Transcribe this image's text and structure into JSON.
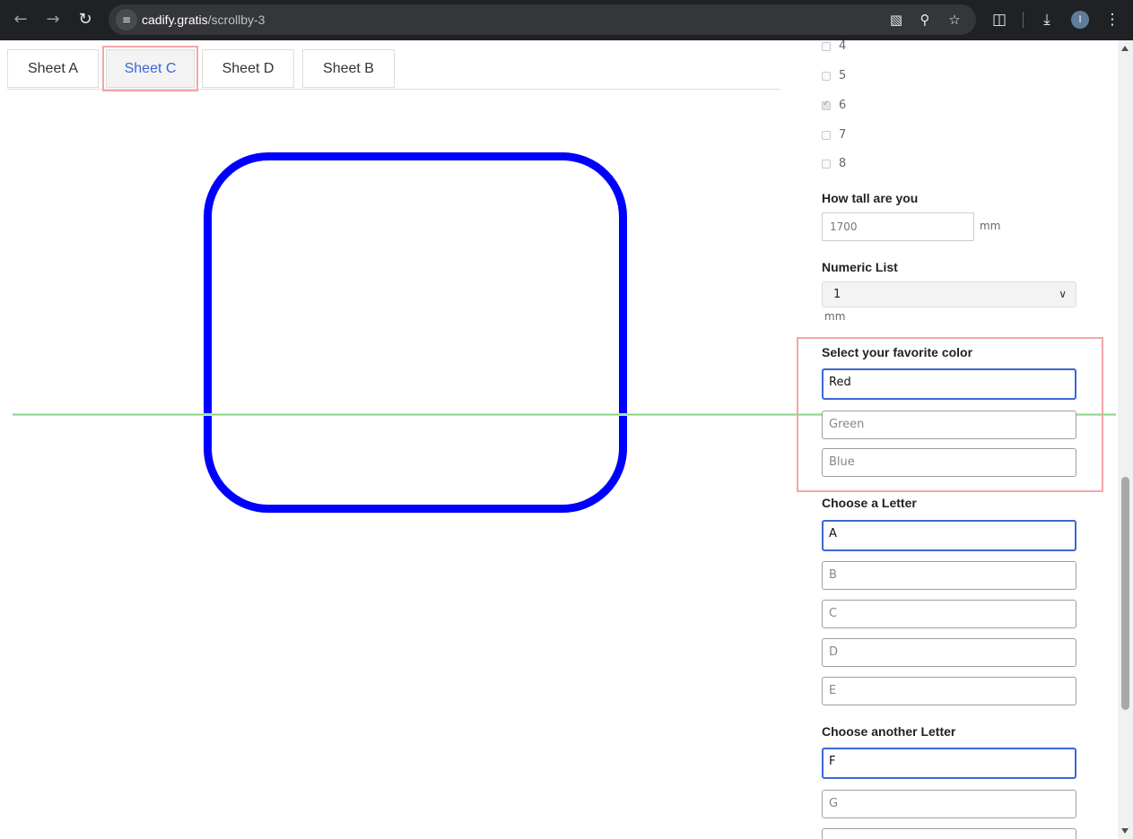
{
  "browser": {
    "url_host": "cadify.gratis",
    "url_path": "/scrollby-3",
    "avatar_letter": "I",
    "icons": [
      "back-icon",
      "forward-icon",
      "reload-icon",
      "site-info-icon",
      "translate-icon",
      "zoom-icon",
      "bookmark-star-icon",
      "extensions-icon",
      "download-icon",
      "more-menu-icon"
    ]
  },
  "tabs": [
    {
      "label": "Sheet A",
      "selected": false
    },
    {
      "label": "Sheet C",
      "selected": true
    },
    {
      "label": "Sheet D",
      "selected": false
    },
    {
      "label": "Sheet B",
      "selected": false
    }
  ],
  "checkboxes": [
    {
      "label": "4",
      "checked": false
    },
    {
      "label": "5",
      "checked": false
    },
    {
      "label": "6",
      "checked": true
    },
    {
      "label": "7",
      "checked": false
    },
    {
      "label": "8",
      "checked": false
    }
  ],
  "height": {
    "label": "How tall are you",
    "value": "1700",
    "unit": "mm"
  },
  "numeric_list": {
    "label": "Numeric List",
    "selected": "1",
    "unit": "mm"
  },
  "color": {
    "label": "Select your favorite color",
    "options": [
      "Red",
      "Green",
      "Blue"
    ]
  },
  "letter": {
    "label": "Choose a Letter",
    "options": [
      "A",
      "B",
      "C",
      "D",
      "E"
    ]
  },
  "another_letter": {
    "label": "Choose another Letter",
    "options": [
      "F",
      "G"
    ]
  },
  "colors": {
    "shape_stroke": "#0000ff",
    "line": "#7fd17f",
    "highlight": "#f3a6a8",
    "focus": "#3b67d6"
  }
}
